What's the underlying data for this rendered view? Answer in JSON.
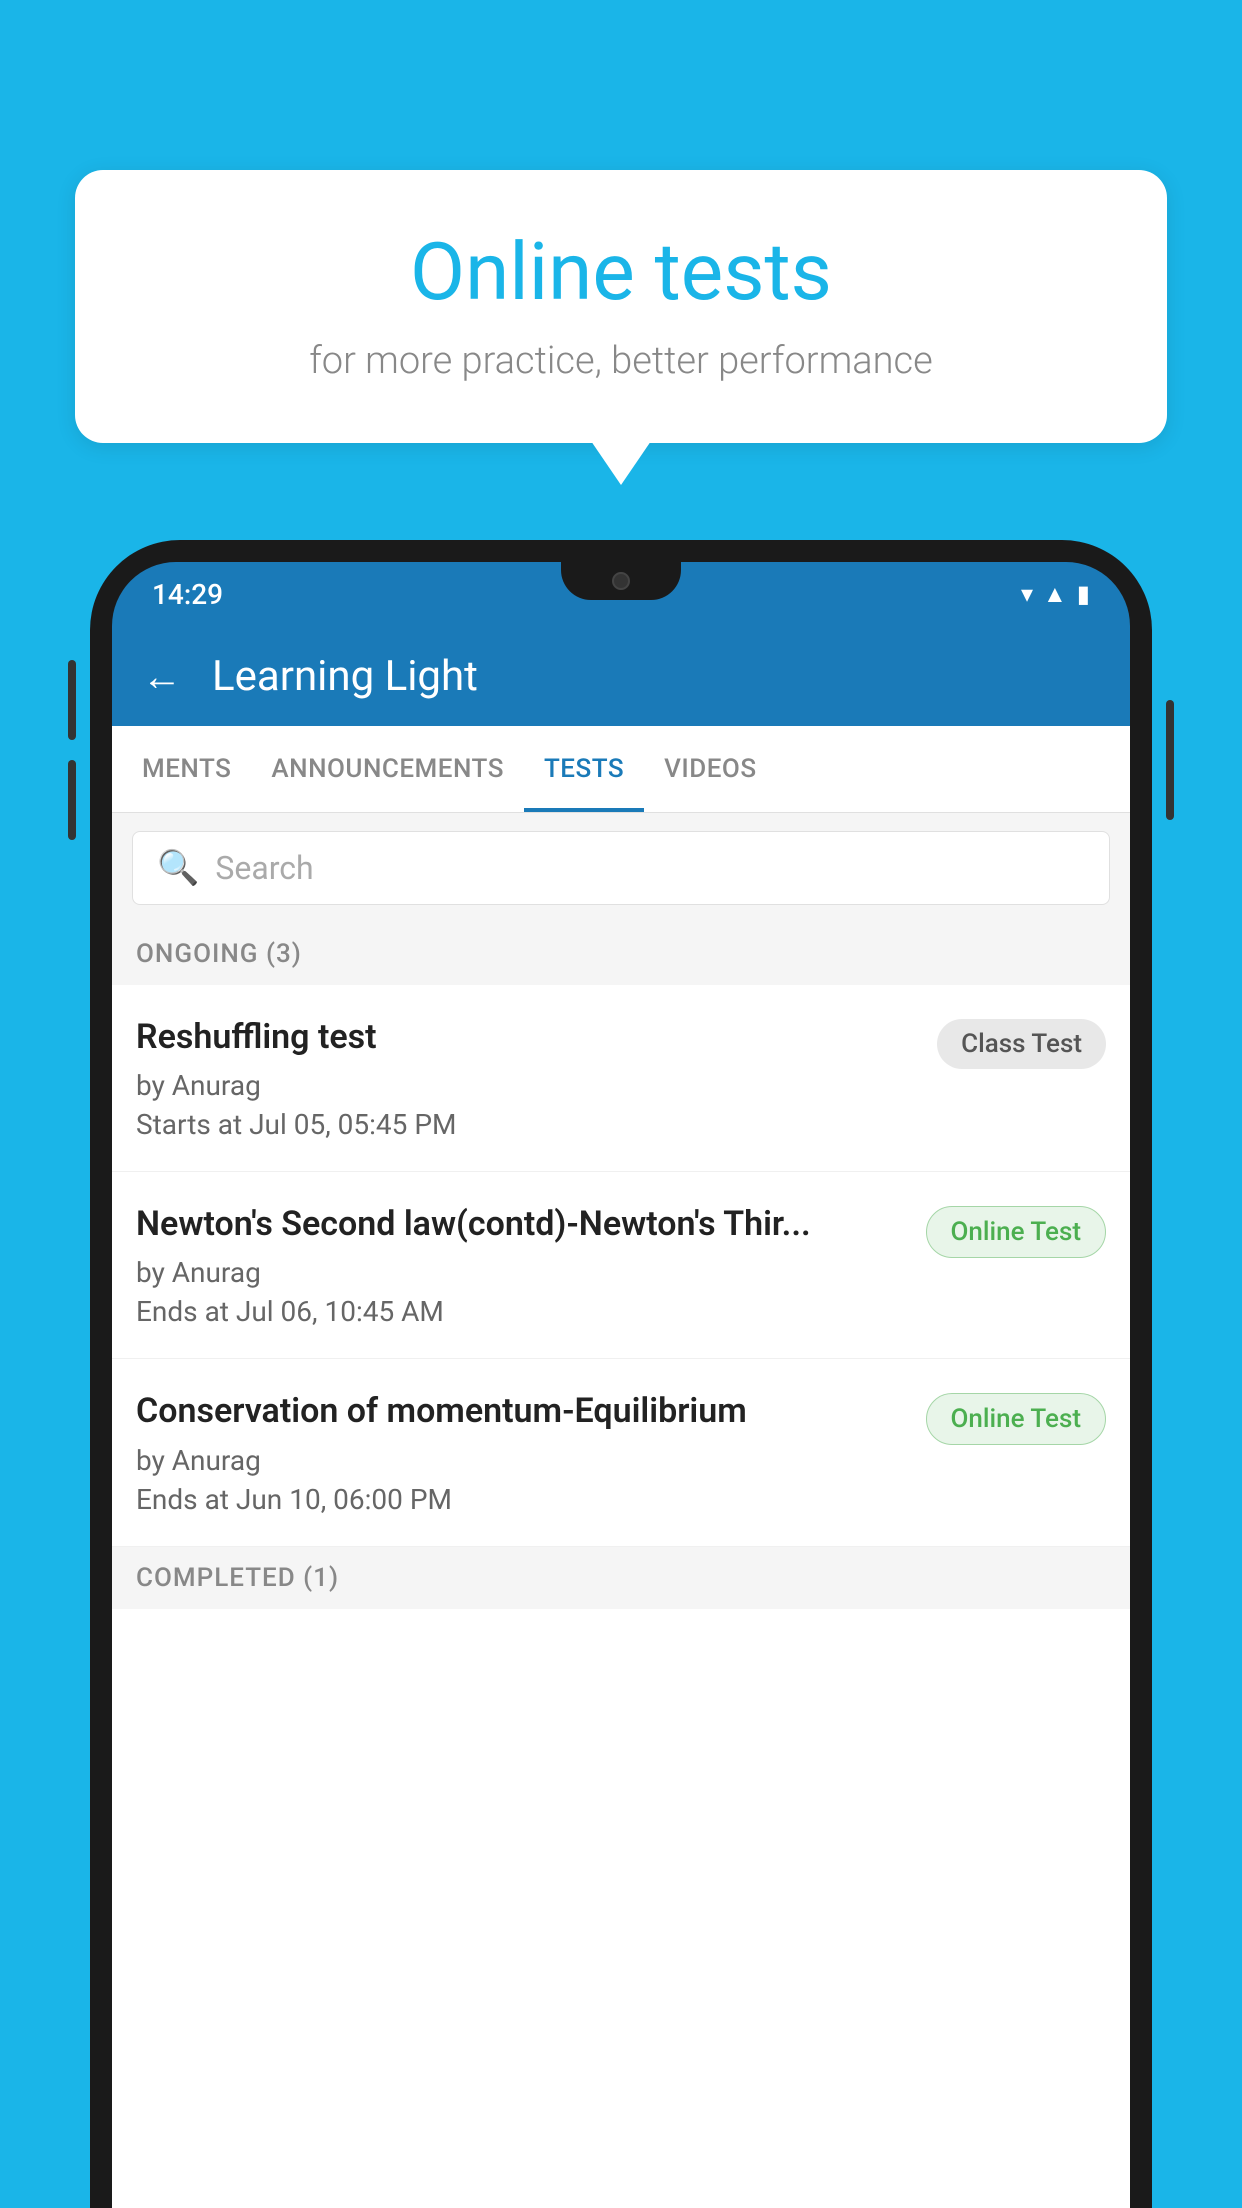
{
  "background_color": "#1ab5e8",
  "bubble": {
    "title": "Online tests",
    "subtitle": "for more practice, better performance"
  },
  "phone": {
    "time": "14:29",
    "status_icons": [
      "wifi",
      "signal",
      "battery"
    ]
  },
  "app": {
    "back_label": "←",
    "title": "Learning Light",
    "tabs": [
      {
        "label": "MENTS",
        "active": false
      },
      {
        "label": "ANNOUNCEMENTS",
        "active": false
      },
      {
        "label": "TESTS",
        "active": true
      },
      {
        "label": "VIDEOS",
        "active": false
      }
    ],
    "search_placeholder": "Search",
    "ongoing_label": "ONGOING (3)",
    "completed_label": "COMPLETED (1)",
    "tests": [
      {
        "name": "Reshuffling test",
        "author": "by Anurag",
        "time_label": "Starts at",
        "time": "Jul 05, 05:45 PM",
        "badge": "Class Test",
        "badge_type": "class"
      },
      {
        "name": "Newton's Second law(contd)-Newton's Thir...",
        "author": "by Anurag",
        "time_label": "Ends at",
        "time": "Jul 06, 10:45 AM",
        "badge": "Online Test",
        "badge_type": "online"
      },
      {
        "name": "Conservation of momentum-Equilibrium",
        "author": "by Anurag",
        "time_label": "Ends at",
        "time": "Jun 10, 06:00 PM",
        "badge": "Online Test",
        "badge_type": "online"
      }
    ]
  }
}
